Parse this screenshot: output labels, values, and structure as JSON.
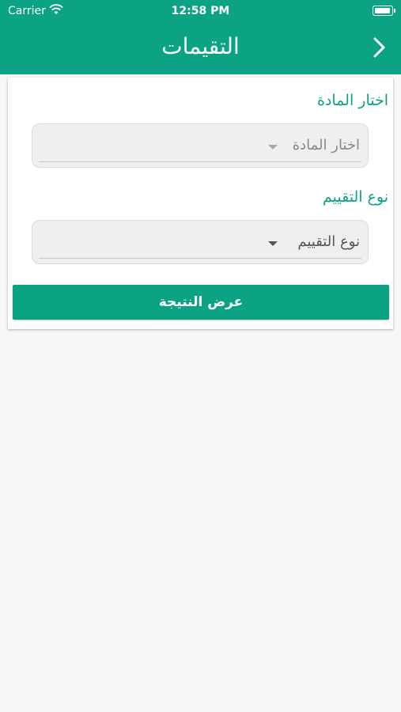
{
  "status_bar": {
    "carrier": "Carrier",
    "time": "12:58 PM"
  },
  "header": {
    "title": "التقيمات",
    "back_icon": "chevron-right-icon"
  },
  "form": {
    "subject_label": "اختار المادة",
    "subject_value": "اختار المادة",
    "evaluation_type_label": "نوع التقييم",
    "evaluation_type_value": "نوع التقييم",
    "submit_label": "عرض النتيجة"
  },
  "colors": {
    "accent": "#0ca384",
    "background": "#f7f7f7"
  }
}
